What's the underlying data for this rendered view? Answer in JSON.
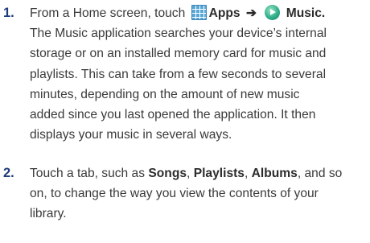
{
  "steps": [
    {
      "number": "1.",
      "line1": {
        "pre": "From a Home screen, touch",
        "apps_icon": "apps-grid-icon",
        "apps_label": "Apps",
        "arrow": "➔",
        "music_icon": "music-play-icon",
        "music_label": "Music",
        "end": "."
      },
      "lines": [
        "The Music application searches your device’s internal",
        "storage or on an installed memory card for music and",
        "playlists. This can take from a few seconds to several",
        "minutes, depending on the amount of new music",
        "added since you last opened the application. It then",
        "displays your music in several ways."
      ]
    },
    {
      "number": "2.",
      "line1": {
        "pre": "Touch a tab, such as",
        "tab1": "Songs",
        "sep1": ", ",
        "tab2": "Playlists",
        "sep2": ", ",
        "tab3": "Albums",
        "post": ", and so"
      },
      "lines": [
        "on, to change the way you view the contents of your",
        "library."
      ]
    }
  ]
}
